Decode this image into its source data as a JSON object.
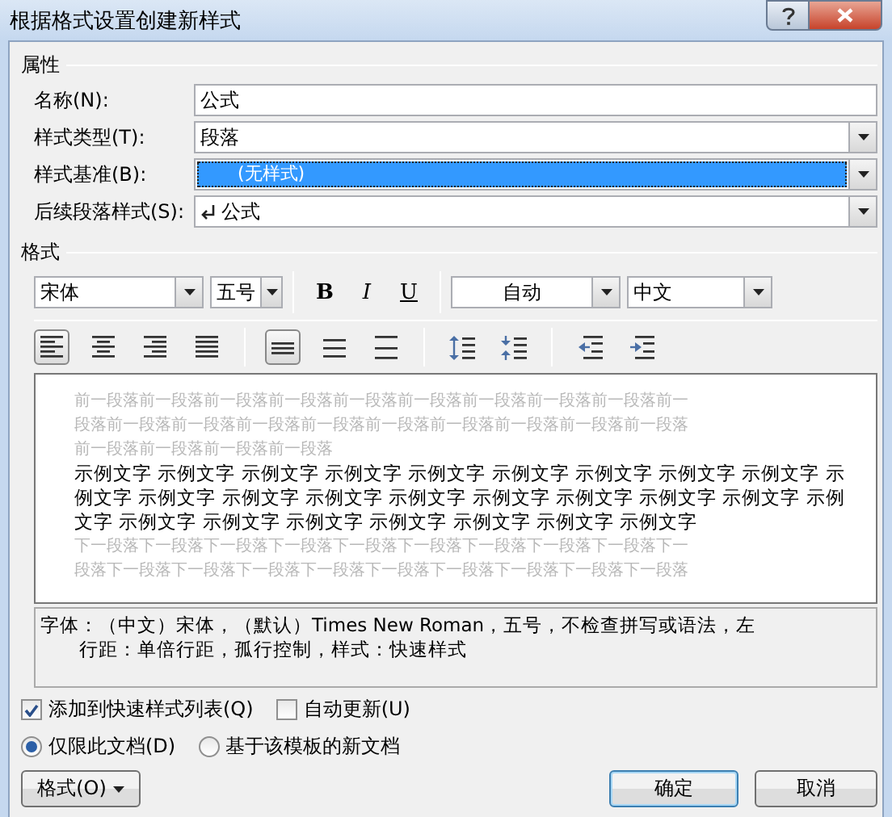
{
  "window": {
    "title": "根据格式设置创建新样式"
  },
  "properties": {
    "heading": "属性",
    "fields": [
      {
        "label": "名称(N):",
        "value": "公式",
        "kind": "text",
        "selected": false
      },
      {
        "label": "样式类型(T):",
        "value": "段落",
        "kind": "dropdown",
        "selected": false
      },
      {
        "label": "样式基准(B):",
        "value": "(无样式)",
        "kind": "dropdown",
        "selected": true
      },
      {
        "label": "后续段落样式(S):",
        "value": "公式",
        "kind": "style-dropdown",
        "selected": false
      }
    ]
  },
  "format": {
    "heading": "格式",
    "font": "宋体",
    "size": "五号",
    "text_buttons": [
      {
        "label": "B",
        "kind": "bold",
        "on": false
      },
      {
        "label": "I",
        "kind": "italic",
        "on": false
      },
      {
        "label": "U",
        "kind": "underline",
        "on": false
      }
    ],
    "font_color": "自动",
    "script": "中文",
    "alignment": [
      {
        "kind": "left",
        "selected": true
      },
      {
        "kind": "center",
        "selected": false
      },
      {
        "kind": "right",
        "selected": false
      },
      {
        "kind": "justify",
        "selected": false
      }
    ],
    "line_spacing": [
      {
        "kind": "single",
        "selected": true
      },
      {
        "kind": "one-half",
        "selected": false
      },
      {
        "kind": "double",
        "selected": false
      }
    ],
    "paragraph_spacing": [
      {
        "kind": "increase"
      },
      {
        "kind": "decrease"
      }
    ],
    "indent": [
      {
        "kind": "decrease"
      },
      {
        "kind": "increase"
      }
    ]
  },
  "preview": {
    "previous_paragraph": [
      "前一段落前一段落前一段落前一段落前一段落前一段落前一段落前一段落前一段落前一",
      "段落前一段落前一段落前一段落前一段落前一段落前一段落前一段落前一段落前一段落",
      "前一段落前一段落前一段落前一段落"
    ],
    "sample_text": [
      "示例文字 示例文字 示例文字 示例文字 示例文字 示例文字 示例文字 示例文字 示例文字 示",
      "例文字 示例文字 示例文字 示例文字 示例文字 示例文字 示例文字 示例文字 示例文字 示例",
      "文字 示例文字 示例文字 示例文字 示例文字 示例文字 示例文字 示例文字"
    ],
    "next_paragraph": [
      "下一段落下一段落下一段落下一段落下一段落下一段落下一段落下一段落下一段落下一",
      "段落下一段落下一段落下一段落下一段落下一段落下一段落下一段落下一段落下一段落"
    ]
  },
  "description": [
    "字体：（中文）宋体，（默认）Times New Roman，五号，不检查拼写或语法，左",
    "行距：单倍行距，孤行控制，样式：快速样式"
  ],
  "options": {
    "checkboxes": [
      {
        "label": "添加到快速样式列表(Q)",
        "checked": true
      },
      {
        "label": "自动更新(U)",
        "checked": false
      }
    ],
    "radios": [
      {
        "label": "仅限此文档(D)",
        "selected": true
      },
      {
        "label": "基于该模板的新文档",
        "selected": false
      }
    ]
  },
  "buttons": {
    "format_menu": "格式(O)",
    "ok": "确定",
    "cancel": "取消"
  }
}
